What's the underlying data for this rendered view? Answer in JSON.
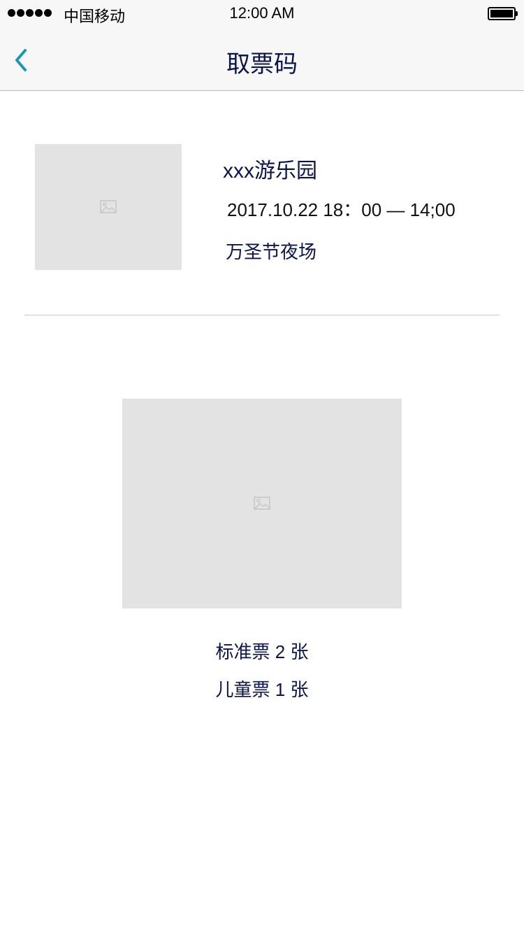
{
  "status_bar": {
    "carrier": "中国移动",
    "time": "12:00 AM",
    "signal_icon": "signal-dots-icon",
    "battery_icon": "battery-icon"
  },
  "nav": {
    "title": "取票码",
    "back_icon": "chevron-left-icon",
    "accent_color": "#1a98b3"
  },
  "event": {
    "name": "xxx游乐园",
    "datetime": "2017.10.22  18：00 — 14;00",
    "session": "万圣节夜场",
    "thumbnail_icon": "image-placeholder-icon"
  },
  "ticket_code": {
    "image_icon": "image-placeholder-icon"
  },
  "tickets": [
    {
      "label": "标准票 2 张"
    },
    {
      "label": "儿童票 1 张"
    }
  ],
  "colors": {
    "text_primary": "#0c1548",
    "bar_background": "#f7f7f7",
    "placeholder_background": "#e3e3e3"
  }
}
